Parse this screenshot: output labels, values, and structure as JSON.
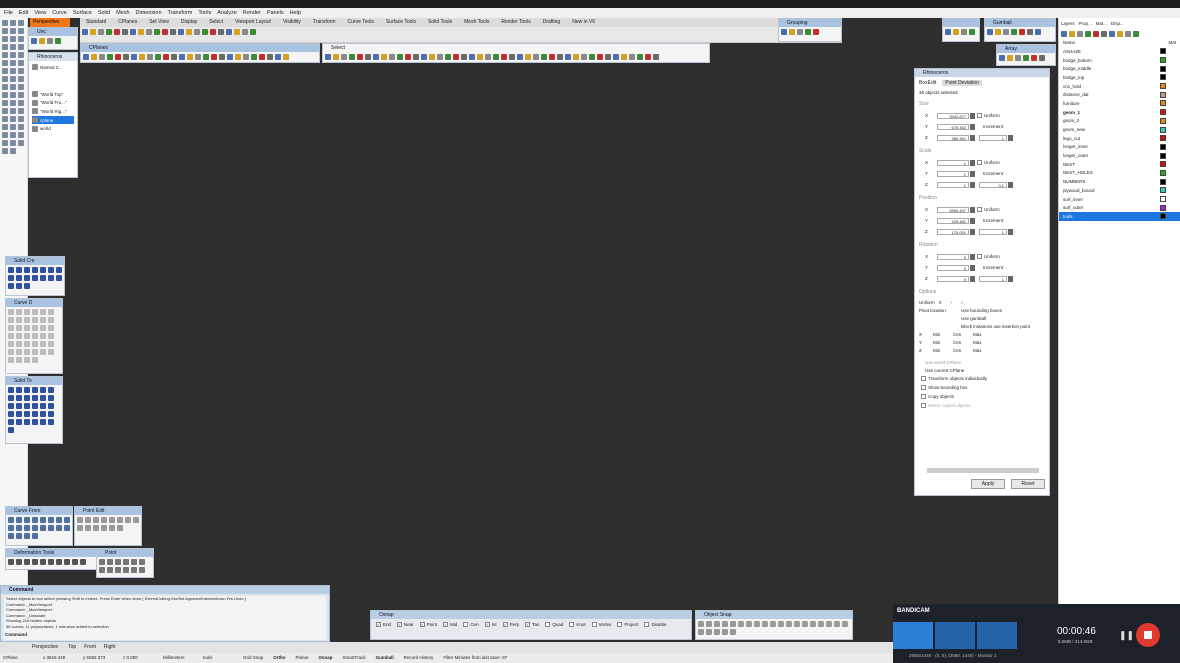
{
  "menu": [
    "File",
    "Edit",
    "View",
    "Curve",
    "Surface",
    "Solid",
    "Mesh",
    "Dimension",
    "Transform",
    "Tools",
    "Analyze",
    "Render",
    "Panels",
    "Help"
  ],
  "viewport_tab": "Perspective",
  "toolbar_tabs": [
    "Standard",
    "CPlanes",
    "Set View",
    "Display",
    "Select",
    "Viewport Layout",
    "Visibility",
    "Transform",
    "Curve Tools",
    "Surface Tools",
    "Solid Tools",
    "Mesh Tools",
    "Render Tools",
    "Drafting",
    "New in V6"
  ],
  "small_toolbars": {
    "unc": "Unc",
    "cplanes": "CPlanes",
    "select": "Select",
    "grouping": "Grouping",
    "gumball": "Gumball",
    "array": "Array",
    "solid_creation": "Solid Cre",
    "curve_drawing": "Curve D",
    "solid_tools": "Solid To",
    "curve_from": "Curve From",
    "point_edit": "Point Edit",
    "deformation": "Deformation Tools",
    "point": "Point"
  },
  "named_views": {
    "title": "Rhinoceros",
    "items": [
      "Named C...",
      "\"World Top\"",
      "\"World Fro...\"",
      "\"World Rig...\"",
      "cplane",
      "world"
    ]
  },
  "layers": {
    "tabs": [
      "Layers",
      "Prop...",
      "Mat...",
      "Disp..."
    ],
    "col_name": "Name",
    "col_mat": "Mat",
    "items": [
      {
        "name": "ASHAZE",
        "color": "#000000"
      },
      {
        "name": "bridge_bottom",
        "color": "#22aa22"
      },
      {
        "name": "bridge_middle",
        "color": "#000000"
      },
      {
        "name": "bridge_top",
        "color": "#000000"
      },
      {
        "name": "cnc_hold",
        "color": "#e08a1e"
      },
      {
        "name": "distance_dat",
        "color": "#c8a070"
      },
      {
        "name": "furniture",
        "color": "#e08a1e"
      },
      {
        "name": "geom_1",
        "color": "#dd1111",
        "current": true
      },
      {
        "name": "geom_2",
        "color": "#e08a1e"
      },
      {
        "name": "geom_new",
        "color": "#33cccc"
      },
      {
        "name": "lego_cut",
        "color": "#cc1111"
      },
      {
        "name": "longer_inner",
        "color": "#000000"
      },
      {
        "name": "longer_outer",
        "color": "#000000"
      },
      {
        "name": "NEST",
        "color": "#cc1111"
      },
      {
        "name": "NEST_HOLES",
        "color": "#22aa22"
      },
      {
        "name": "NUMBERS",
        "color": "#000000"
      },
      {
        "name": "plywood_bound",
        "color": "#33cccc"
      },
      {
        "name": "surf_inner",
        "color": "#ffffff"
      },
      {
        "name": "surf_outer",
        "color": "#aa22cc"
      },
      {
        "name": "tools",
        "color": "#000000",
        "selected": true
      }
    ]
  },
  "boxedit": {
    "title": "Rhinoceros",
    "tabs": [
      "BoxEdit",
      "Point Deviation"
    ],
    "selected": "36 objects selected",
    "sections": [
      {
        "name": "Size",
        "x": "3942.877",
        "y": "675.452",
        "z": "369.391",
        "inc": "1"
      },
      {
        "name": "Scale",
        "x": "1",
        "y": "1",
        "z": "1",
        "inc": "0.1"
      },
      {
        "name": "Position",
        "x": "2690.437",
        "y": "329.481",
        "z": "175.001",
        "inc": "1"
      },
      {
        "name": "Rotation",
        "x": "0",
        "y": "0",
        "z": "0",
        "inc": "1"
      }
    ],
    "uniform": "Uniform",
    "increment": "Increment",
    "options": "Options",
    "uniform_axes": [
      "X",
      "Y",
      "Z"
    ],
    "pivot_label": "Pivot location",
    "pivot_opts": [
      "Use bounding boxes",
      "Use gumball",
      "Block instances use insertion point"
    ],
    "minmax": [
      "Min",
      "Cen",
      "Max"
    ],
    "cplane_opts": [
      "Use world CPlane",
      "Use current CPlane"
    ],
    "checks": [
      "Transform objects individually",
      "Show bounding box",
      "Copy objects",
      "Select copied objects"
    ],
    "apply": "Apply",
    "reset": "Reset"
  },
  "command": {
    "title": "Command",
    "lines": [
      "Select objects to box select pressing Shift to extend. Press Enter when done ( ExtendCutting=NoHist  ApparentIntersections=Yes  Undo )",
      "Command: _MaxViewport",
      "Command: _MaxViewport",
      "Command: _Unisolate",
      "Showing 216 hidden objects",
      "36 curves, 11 polysurfaces, 1 extrusion added to selection."
    ],
    "prompt": "Command"
  },
  "view_tabs": [
    "Perspective",
    "Top",
    "Front",
    "Right"
  ],
  "status": {
    "cplane": "CPlane",
    "x": "x 3618.449",
    "y": "y 5082.073",
    "z": "z 0.000",
    "units": "Millimeters",
    "layer": "tools",
    "items": [
      "Grid Snap",
      "Ortho",
      "Planar",
      "Osnap",
      "SmartTrack",
      "Gumball",
      "Record History",
      "Filter  Minutes from last save: 87"
    ]
  },
  "osnap": {
    "title": "Osnap",
    "items": [
      {
        "l": "End",
        "c": true
      },
      {
        "l": "Near",
        "c": true
      },
      {
        "l": "Point",
        "c": true
      },
      {
        "l": "Mid",
        "c": true
      },
      {
        "l": "Cen",
        "c": false
      },
      {
        "l": "Int",
        "c": true
      },
      {
        "l": "Perp",
        "c": true
      },
      {
        "l": "Tan",
        "c": true
      },
      {
        "l": "Quad",
        "c": false
      },
      {
        "l": "Knot",
        "c": false
      },
      {
        "l": "Vertex",
        "c": false
      },
      {
        "l": "Project",
        "c": false
      },
      {
        "l": "Disable",
        "c": false
      }
    ]
  },
  "object_snap": "Object Snap",
  "bandicam": {
    "logo": "BANDICAM",
    "time": "00:00:46",
    "size": "5.0MB / 414.9GB",
    "region": "2560x1440 - (0, 0), (2560, 1440) - Monitor 1"
  }
}
